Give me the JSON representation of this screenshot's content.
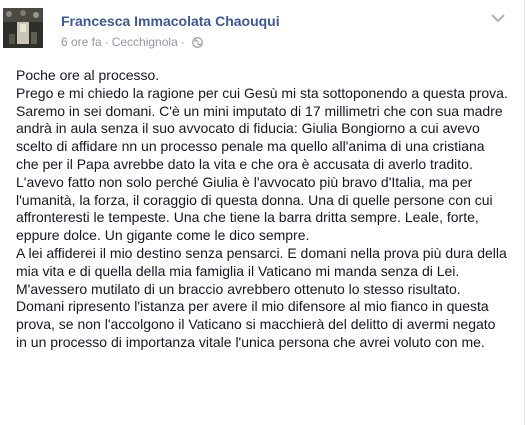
{
  "post": {
    "author": "Francesca Immacolata Chaouqui",
    "time": "6 ore fa",
    "separator": "·",
    "location": "Cecchignola",
    "privacy_icon": "globe-icon",
    "menu_icon": "chevron-down-icon",
    "paragraphs": [
      "Poche ore al processo.",
      "Prego e mi chiedo la ragione per cui Gesù mi sta sottoponendo a questa prova.",
      "Saremo in sei domani. C'è un mini imputato di 17 millimetri che con sua madre andrà in aula senza il suo avvocato di fiducia: Giulia Bongiorno a cui avevo scelto di affidare nn un processo penale ma quello all'anima di una cristiana che per il Papa avrebbe dato la vita e che ora è accusata di averlo tradito. L'avevo fatto non solo perché Giulia è l'avvocato più bravo d'Italia, ma per l'umanità, la forza, il coraggio di questa donna. Una di quelle persone con cui affronteresti le tempeste. Una che tiene la barra dritta sempre. Leale, forte, eppure dolce. Un gigante come le dico sempre.",
      "A lei affiderei il mio destino senza pensarci. E domani nella prova più dura della mia vita e di quella della mia famiglia il Vaticano mi manda senza di Lei. M'avessero mutilato di un braccio avrebbero ottenuto lo stesso risultato.",
      "Domani ripresento l'istanza per avere il mio difensore al mio fianco in questa prova, se non l'accolgono il Vaticano si macchierà del delitto di avermi negato in un processo di importanza vitale l'unica persona che avrei voluto con me."
    ]
  },
  "colors": {
    "author_link": "#3b5998",
    "meta_text": "#9197a3",
    "body_text": "#141823"
  }
}
